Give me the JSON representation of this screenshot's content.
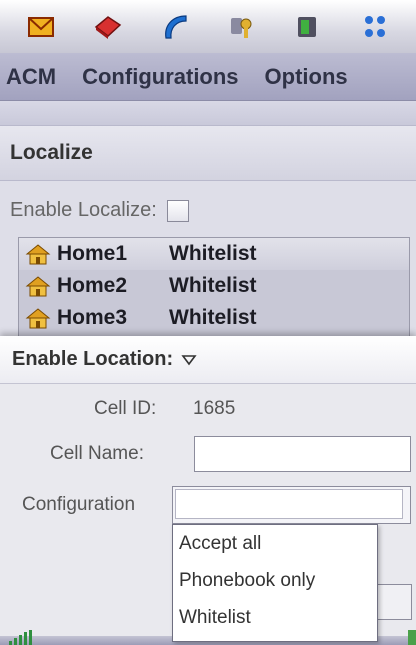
{
  "toolbar": {
    "icons": [
      "mail-icon",
      "book-icon",
      "phone-icon",
      "key-icon",
      "device-icon",
      "apps-grid-icon"
    ]
  },
  "menu": {
    "items": [
      "ACM",
      "Configurations",
      "Options"
    ]
  },
  "localize": {
    "title": "Localize",
    "enable_label": "Enable Localize:",
    "enable_checked": false,
    "list": [
      {
        "name": "Home1",
        "type": "Whitelist"
      },
      {
        "name": "Home2",
        "type": "Whitelist"
      },
      {
        "name": "Home3",
        "type": "Whitelist"
      }
    ]
  },
  "location": {
    "title": "Enable Location:",
    "cell_id_label": "Cell ID:",
    "cell_id_value": "1685",
    "cell_name_label": "Cell Name:",
    "cell_name_value": "",
    "configuration_label": "Configuration",
    "configuration_value": "",
    "options": [
      "Accept all",
      "Phonebook only",
      "Whitelist"
    ]
  },
  "colors": {
    "menubar": "#a2a2bf",
    "signal": "#2f8f3f"
  }
}
